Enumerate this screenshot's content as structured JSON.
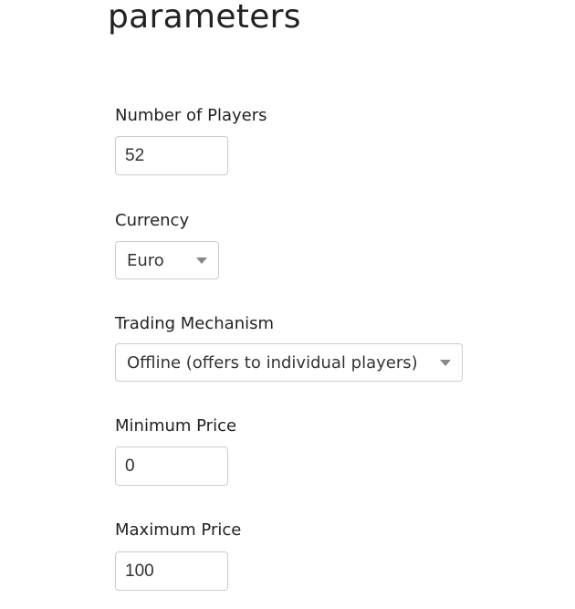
{
  "page": {
    "title": "parameters"
  },
  "fields": {
    "players": {
      "label": "Number of Players",
      "value": "52"
    },
    "currency": {
      "label": "Currency",
      "selected": "Euro",
      "icon": "caret-down-icon"
    },
    "trading": {
      "label": "Trading Mechanism",
      "selected": "Offline (offers to individual players)",
      "icon": "caret-down-icon"
    },
    "min_price": {
      "label": "Minimum Price",
      "value": "0"
    },
    "max_price": {
      "label": "Maximum Price",
      "value": "100"
    }
  }
}
